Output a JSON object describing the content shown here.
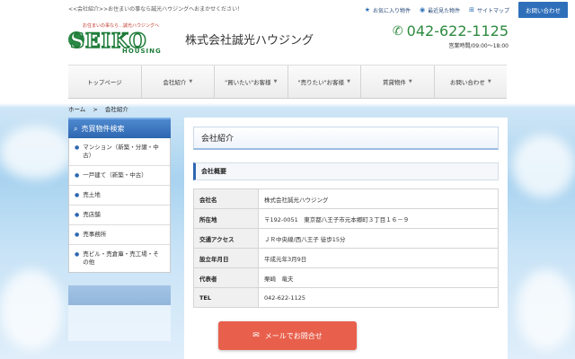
{
  "topbar": {
    "tagline": "<<会社紹介>>お住まいの事なら誠光ハウジングへおまかせください！",
    "links": [
      {
        "icon": "star-icon",
        "label": "お気に入り物件"
      },
      {
        "icon": "eye-icon",
        "label": "最近見た物件"
      },
      {
        "icon": "sitemap-icon",
        "label": "サイトマップ"
      }
    ],
    "contact_label": "お問い合わせ"
  },
  "header": {
    "logo_tag": "お住まいの事なら…誠光ハウジングへ",
    "logo_main": "SEIKO",
    "logo_sub": "HOUSING",
    "company_name": "株式会社誠光ハウジング",
    "phone": "042-622-1125",
    "hours": "営業時間/09:00～18:00"
  },
  "nav": [
    {
      "label": "トップページ",
      "has_arrow": false
    },
    {
      "label": "会社紹介",
      "has_arrow": true
    },
    {
      "label": "\"買いたい\"お客様",
      "has_arrow": true
    },
    {
      "label": "\"売りたい\"お客様",
      "has_arrow": true
    },
    {
      "label": "賃貸物件",
      "has_arrow": true
    },
    {
      "label": "お問い合わせ",
      "has_arrow": true
    }
  ],
  "breadcrumb": {
    "home": "ホーム",
    "sep": ">",
    "current": "会社紹介"
  },
  "sidebar": {
    "title": "売買物件検索",
    "items": [
      "マンション（新築・分譲・中古）",
      "一戸建て（新築・中古）",
      "売土地",
      "売店舗",
      "売事務所",
      "売ビル・売倉庫・売工場・その他"
    ]
  },
  "main": {
    "page_title": "会社紹介",
    "section_title": "会社概要",
    "rows": [
      {
        "key": "会社名",
        "value": "株式会社誠光ハウジング"
      },
      {
        "key": "所在地",
        "value": "〒192-0051　東京都八王子市元本郷町３丁目１６－９"
      },
      {
        "key": "交通アクセス",
        "value": "ＪＲ中央線/西八王子 徒歩15分"
      },
      {
        "key": "設立年月日",
        "value": "平成元年3月9日"
      },
      {
        "key": "代表者",
        "value": "栗崎　竜夫"
      },
      {
        "key": "TEL",
        "value": "042-622-1125"
      }
    ]
  },
  "mail_button": {
    "icon": "envelope-icon",
    "label": "メールでお問合せ"
  }
}
